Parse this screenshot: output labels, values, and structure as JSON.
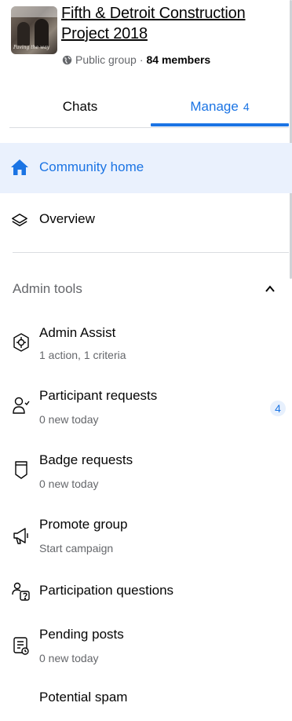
{
  "group": {
    "title": "Fifth & Detroit Construction Project 2018",
    "privacy": "Public group",
    "separator": "·",
    "members": "84 members",
    "avatar_script": "Paving the way"
  },
  "tabs": [
    {
      "label": "Chats"
    },
    {
      "label": "Manage",
      "badge": "4"
    }
  ],
  "nav": {
    "home_label": "Community home",
    "overview_label": "Overview"
  },
  "admin_tools": {
    "header": "Admin tools",
    "items": [
      {
        "title": "Admin Assist",
        "subtitle": "1 action, 1 criteria",
        "icon": "admin-assist-icon"
      },
      {
        "title": "Participant requests",
        "subtitle": "0 new today",
        "icon": "participant-requests-icon",
        "badge": "4"
      },
      {
        "title": "Badge requests",
        "subtitle": "0 new today",
        "icon": "badge-icon"
      },
      {
        "title": "Promote group",
        "subtitle": "Start campaign",
        "icon": "megaphone-icon"
      },
      {
        "title": "Participation questions",
        "icon": "questions-icon"
      },
      {
        "title": "Pending posts",
        "subtitle": "0 new today",
        "icon": "pending-posts-icon"
      },
      {
        "title": "Potential spam",
        "icon": "spam-icon"
      }
    ]
  },
  "colors": {
    "accent": "#1b74e4",
    "selected_bg": "#eaf1fd",
    "secondary_text": "#65676b",
    "divider": "#dadde1"
  }
}
